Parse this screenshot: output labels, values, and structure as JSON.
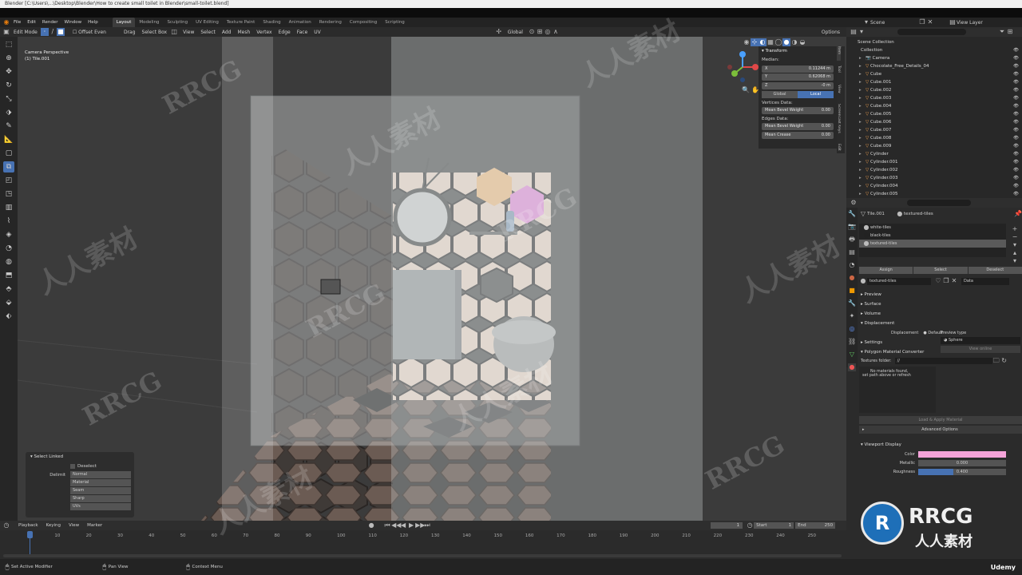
{
  "window": {
    "title": "Blender [C:\\Users\\...\\Desktop\\Blender\\How to create small toilet in Blender\\small-toilet.blend]"
  },
  "menu": [
    "File",
    "Edit",
    "Render",
    "Window",
    "Help"
  ],
  "workspaces": [
    "Layout",
    "Modeling",
    "Sculpting",
    "UV Editing",
    "Texture Paint",
    "Shading",
    "Animation",
    "Rendering",
    "Compositing",
    "Scripting"
  ],
  "active_workspace": "Layout",
  "scene": {
    "name": "Scene",
    "view_layer": "View Layer"
  },
  "header": {
    "mode": "Edit Mode",
    "offset_even": "Offset Even",
    "drag_label": "Drag",
    "select_box": "Select Box",
    "menus": [
      "View",
      "Select",
      "Add",
      "Mesh",
      "Vertex",
      "Edge",
      "Face",
      "UV"
    ],
    "transform_orientation": "Global",
    "options": "Options"
  },
  "viewport": {
    "camera_label": "Camera Perspective",
    "object_label": "(1) Tile.001"
  },
  "transform_panel": {
    "title": "Transform",
    "median_label": "Median:",
    "x_label": "X",
    "x_value": "0.11244 m",
    "y_label": "Y",
    "y_value": "0.62068 m",
    "z_label": "Z",
    "z_value": "-0 m",
    "global_label": "Global",
    "local_label": "Local",
    "vertices_data": "Vertices Data:",
    "mean_bevel_weight_v": "Mean Bevel Weight",
    "mean_bevel_weight_v_val": "0.00",
    "edges_data": "Edges Data:",
    "mean_bevel_weight_e": "Mean Bevel Weight",
    "mean_bevel_weight_e_val": "0.00",
    "mean_crease": "Mean Crease",
    "mean_crease_val": "0.00"
  },
  "side_tabs": [
    "Item",
    "Tool",
    "View",
    "Screencast Keys",
    "Edit"
  ],
  "select_linked": {
    "title": "Select Linked",
    "deselect": "Deselect",
    "delimit_label": "Delimit",
    "options": [
      "Normal",
      "Material",
      "Seam",
      "Sharp",
      "UVs"
    ]
  },
  "outliner": {
    "scene_collection": "Scene Collection",
    "collection": "Collection",
    "items": [
      "Camera",
      "Chocolate_Free_Details_04",
      "Cube",
      "Cube.001",
      "Cube.002",
      "Cube.003",
      "Cube.004",
      "Cube.005",
      "Cube.006",
      "Cube.007",
      "Cube.008",
      "Cube.009",
      "Cylinder",
      "Cylinder.001",
      "Cylinder.002",
      "Cylinder.003",
      "Cylinder.004",
      "Cylinder.005"
    ]
  },
  "properties": {
    "object_name": "Tile.001",
    "material_name": "textured-tiles",
    "slots": [
      "white-tiles",
      "black-tiles",
      "textured-tiles"
    ],
    "assign": "Assign",
    "select": "Select",
    "deselect": "Deselect",
    "data_label": "Data",
    "sections": [
      "Preview",
      "Surface",
      "Volume",
      "Displacement"
    ],
    "displacement_label": "Displacement",
    "displacement_value": "Default",
    "settings": "Settings",
    "polygon_converter": "Polygon Material Converter",
    "textures_folder": "Textures folder:",
    "textures_folder_value": "//",
    "no_materials": "No materials found,",
    "set_path": "set path above or refresh",
    "preview_type": "Preview type",
    "preview_type_value": "Sphere",
    "view_online": "View online",
    "load_apply": "Load & Apply Material",
    "advanced": "Advanced Options",
    "viewport_display": "Viewport Display",
    "color_label": "Color",
    "metallic_label": "Metallic",
    "metallic_value": "0.000",
    "roughness_label": "Roughness",
    "roughness_value": "0.400",
    "viewport_color": "#f5a3d9",
    "roughness_fraction": 0.4
  },
  "timeline": {
    "menus": [
      "Playback",
      "Keying",
      "View",
      "Marker"
    ],
    "current_frame": "1",
    "start_label": "Start",
    "start_value": "1",
    "end_label": "End",
    "end_value": "250",
    "ticks": [
      "1",
      "10",
      "20",
      "30",
      "40",
      "50",
      "60",
      "70",
      "80",
      "90",
      "100",
      "110",
      "120",
      "130",
      "140",
      "150",
      "160",
      "170",
      "180",
      "190",
      "200",
      "210",
      "220",
      "230",
      "240",
      "250"
    ]
  },
  "status": {
    "left": "Set Active Modifier",
    "middle": "Pan View",
    "right": "Context Menu"
  },
  "watermarks": {
    "rrcg": "RRCG",
    "cn": "人人素材",
    "brand_cn": "人人素材",
    "udemy": "Udemy"
  },
  "colors": {
    "accent": "#4772b3",
    "tile_pink": "#e8c8b4",
    "hex_pink": "#e384d9",
    "hex_orange": "#f2b878"
  }
}
